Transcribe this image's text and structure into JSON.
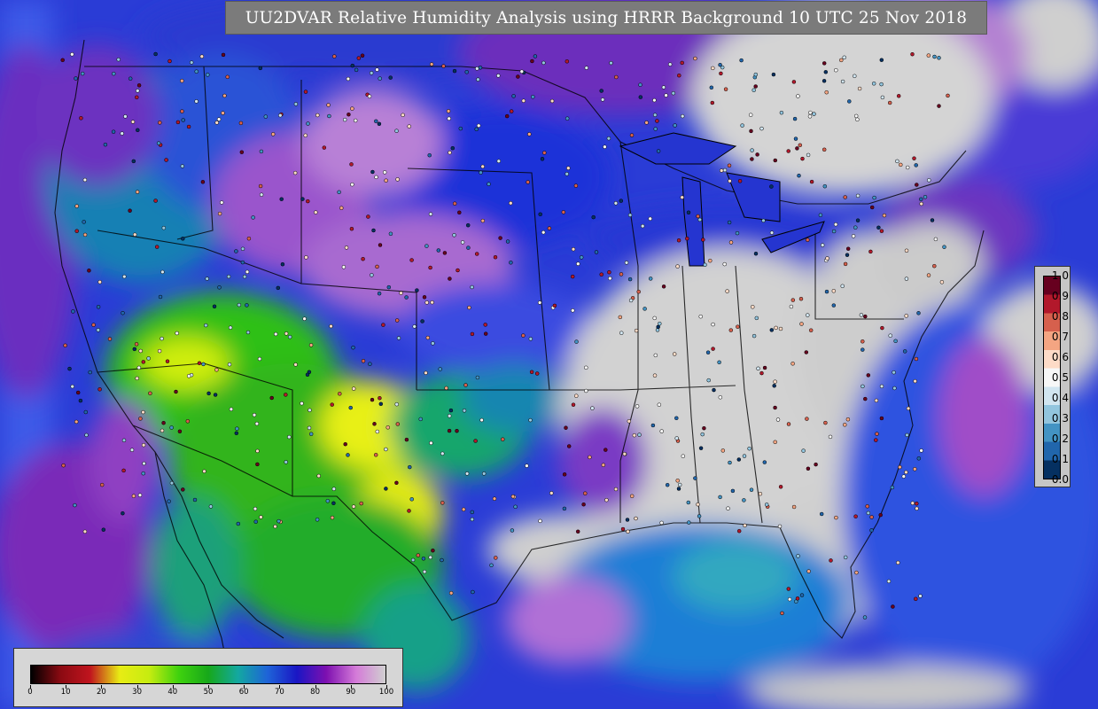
{
  "title": "UU2DVAR Relative Humidity Analysis using HRRR Background 10 UTC 25 Nov 2018",
  "map_legend": {
    "tick_labels": [
      "0",
      "10",
      "20",
      "30",
      "40",
      "50",
      "60",
      "70",
      "80",
      "90",
      "100"
    ],
    "colors": [
      "#000000",
      "#8b0a12",
      "#c0141e",
      "#e8ec14",
      "#c6ec10",
      "#3fd20e",
      "#17a81a",
      "#13a8a0",
      "#1e64d8",
      "#1a16c4",
      "#7e10b0",
      "#d47ad8",
      "#d0d0d0"
    ]
  },
  "obs_legend": {
    "tick_labels": [
      "1.0",
      "0.9",
      "0.8",
      "0.7",
      "0.6",
      "0.5",
      "0.4",
      "0.3",
      "0.2",
      "0.1",
      "0.0"
    ],
    "colors": [
      "#67001f",
      "#b2182b",
      "#d6604d",
      "#f4a582",
      "#fddbc7",
      "#f7f7f7",
      "#d1e5f0",
      "#92c5de",
      "#4393c3",
      "#2166ac",
      "#053061"
    ]
  }
}
